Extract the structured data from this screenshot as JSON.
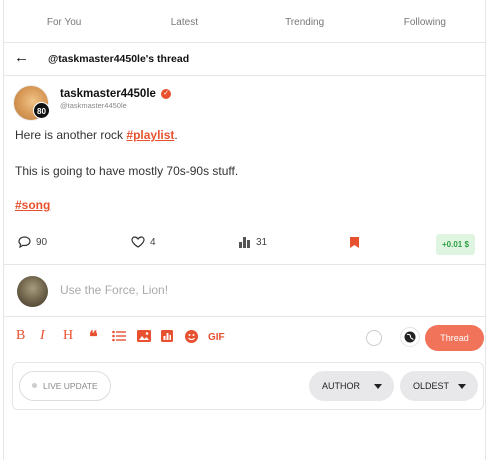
{
  "tabs": [
    "For You",
    "Latest",
    "Trending",
    "Following"
  ],
  "thread_header": {
    "title": "@taskmaster4450le's thread"
  },
  "post": {
    "username": "taskmaster4450le",
    "handle": "@taskmaster4450le",
    "level": "80",
    "line1_text": "Here is another rock ",
    "line1_tag": "#playlist",
    "line1_end": ".",
    "line2": "This is going to have mostly 70s-90s stuff.",
    "tag2": "#song"
  },
  "actions": {
    "comments": "90",
    "likes": "4",
    "views": "31",
    "tip": "+0.01 $"
  },
  "reply": {
    "placeholder": "Use the Force, Lion!",
    "gif_label": "GIF",
    "submit_label": "Thread"
  },
  "filters": {
    "live_update": "LIVE UPDATE",
    "author": "AUTHOR",
    "sort": "OLDEST"
  },
  "colors": {
    "accent": "#e8512f",
    "button": "#f0735a",
    "tip_bg": "#dff5e1",
    "tip_text": "#2ea043"
  },
  "icons": [
    "back-arrow-icon",
    "verified-icon",
    "comment-icon",
    "heart-icon",
    "bar-chart-icon",
    "bookmark-icon",
    "bold-icon",
    "italic-icon",
    "heading-icon",
    "quote-icon",
    "list-icon",
    "image-icon",
    "chart-icon",
    "emoji-icon",
    "globe-icon"
  ]
}
